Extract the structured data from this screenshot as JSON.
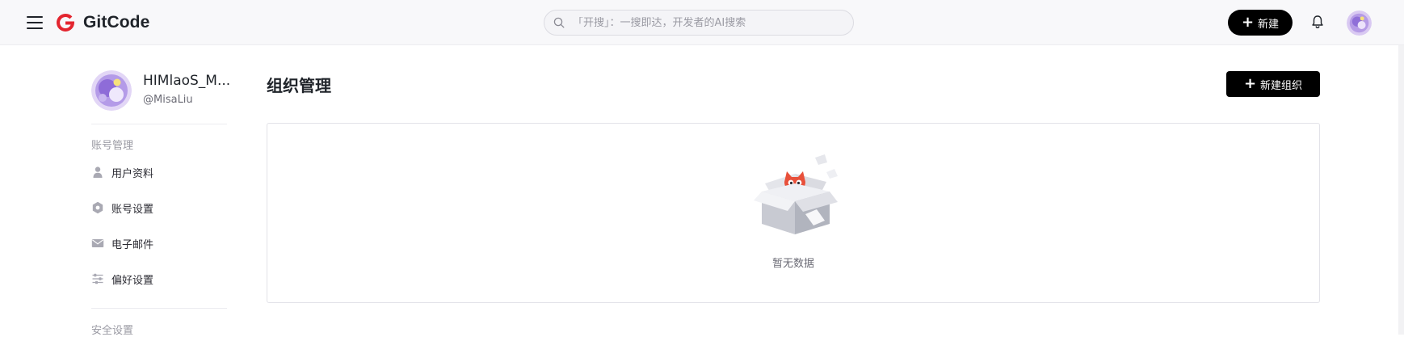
{
  "header": {
    "logo_text": "GitCode",
    "search": {
      "placeholder": "「开搜」：一搜即达，开发者的AI搜索",
      "value": ""
    },
    "new_button": "新建",
    "icons": [
      "menu-icon",
      "gitcode-logo",
      "search-icon",
      "bell-icon",
      "user-avatar"
    ]
  },
  "profile": {
    "name": "HIMlaoS_M...",
    "handle": "@MisaLiu"
  },
  "sidebar": {
    "sections": [
      {
        "title": "账号管理",
        "items": [
          {
            "label": "用户资料",
            "icon": "user-icon"
          },
          {
            "label": "账号设置",
            "icon": "gear-icon"
          },
          {
            "label": "电子邮件",
            "icon": "mail-icon"
          },
          {
            "label": "偏好设置",
            "icon": "sliders-icon"
          }
        ]
      },
      {
        "title": "安全设置",
        "items": []
      }
    ]
  },
  "main": {
    "title": "组织管理",
    "new_org_button": "新建组织",
    "empty_text": "暂无数据"
  },
  "colors": {
    "brand": "#e3252f",
    "primary_button": "#000000",
    "header_bg": "#f8f8fa"
  }
}
